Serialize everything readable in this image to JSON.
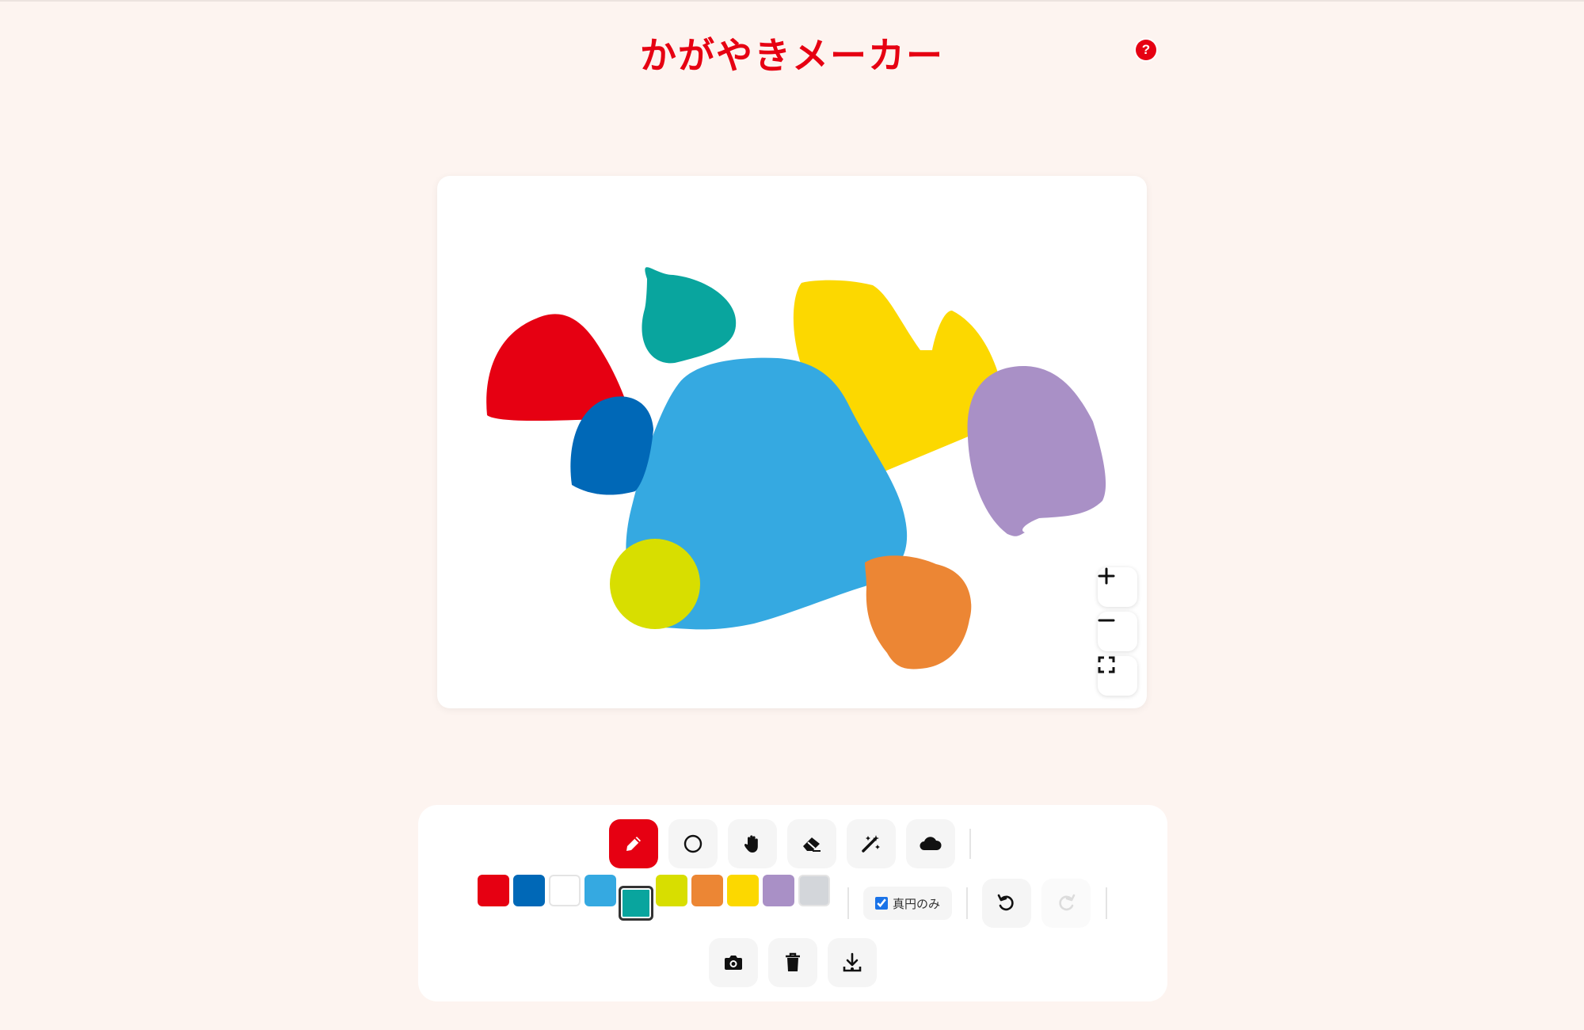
{
  "app": {
    "title": "かがやきメーカー",
    "help_label": "?"
  },
  "colors": {
    "accent": "#e60012",
    "background": "#fdf4f0",
    "palette": [
      "#e60012",
      "#0068b7",
      "#ffffff",
      "#35a9e1",
      "#09a59e",
      "#d8de00",
      "#ec8634",
      "#fcd800",
      "#a990c6",
      "#d3d6da"
    ],
    "selected_palette_index": 4
  },
  "canvas": {
    "shapes": [
      {
        "name": "red-blob",
        "color": "#e60012"
      },
      {
        "name": "teal-blob",
        "color": "#09a59e"
      },
      {
        "name": "dark-blue-blob",
        "color": "#0068b7"
      },
      {
        "name": "light-blue-blob",
        "color": "#35a9e1"
      },
      {
        "name": "yellow-blob",
        "color": "#fcd800"
      },
      {
        "name": "purple-blob",
        "color": "#a990c6"
      },
      {
        "name": "lime-blob",
        "color": "#d8de00"
      },
      {
        "name": "orange-blob",
        "color": "#ec8634"
      }
    ],
    "zoom_controls": [
      {
        "name": "zoom-in-button",
        "icon": "plus-icon"
      },
      {
        "name": "zoom-out-button",
        "icon": "minus-icon"
      },
      {
        "name": "fullscreen-button",
        "icon": "fullscreen-icon"
      }
    ]
  },
  "toolbar": {
    "tools": [
      {
        "name": "pen-tool",
        "icon": "pencil-icon",
        "active": true
      },
      {
        "name": "circle-tool",
        "icon": "circle-icon",
        "active": false
      },
      {
        "name": "hand-tool",
        "icon": "hand-icon",
        "active": false
      },
      {
        "name": "eraser-tool",
        "icon": "eraser-icon",
        "active": false
      },
      {
        "name": "magic-tool",
        "icon": "magic-wand-icon",
        "active": false
      },
      {
        "name": "cloud-tool",
        "icon": "cloud-icon",
        "active": false
      }
    ],
    "circle_only_label": "真円のみ",
    "circle_only_checked": true,
    "history": [
      {
        "name": "undo-button",
        "icon": "undo-icon",
        "enabled": true
      },
      {
        "name": "redo-button",
        "icon": "redo-icon",
        "enabled": false
      }
    ],
    "actions": [
      {
        "name": "camera-button",
        "icon": "camera-icon"
      },
      {
        "name": "delete-button",
        "icon": "trash-icon"
      },
      {
        "name": "download-button",
        "icon": "download-icon"
      }
    ]
  }
}
